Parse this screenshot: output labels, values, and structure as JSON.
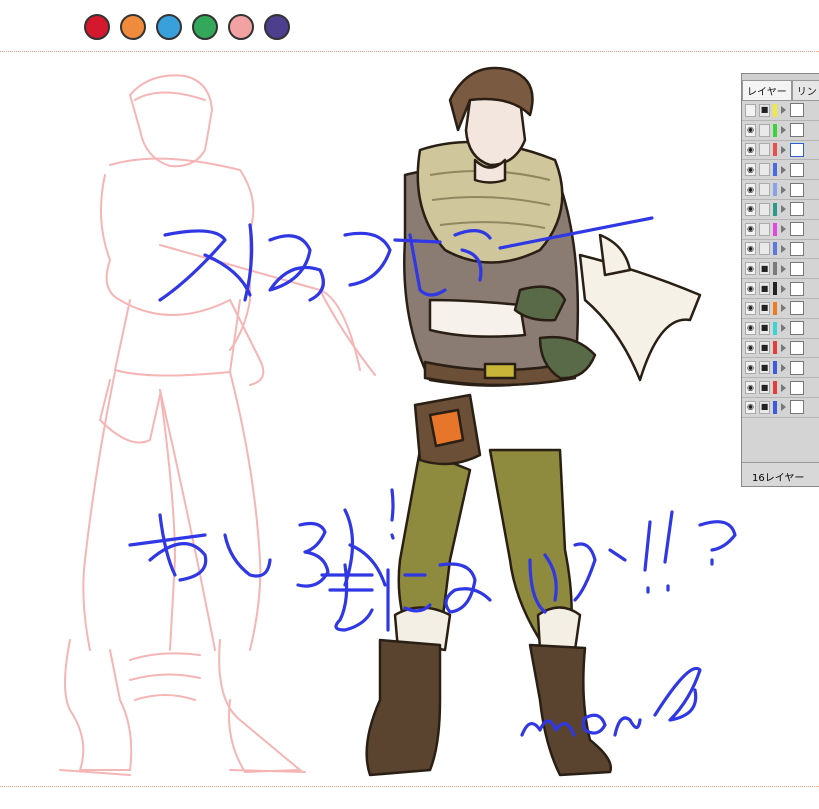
{
  "palette": [
    {
      "name": "red",
      "color": "#d4182e"
    },
    {
      "name": "orange",
      "color": "#f08a3c"
    },
    {
      "name": "blue",
      "color": "#3aa0dc"
    },
    {
      "name": "green",
      "color": "#34a85a"
    },
    {
      "name": "pink",
      "color": "#f2a2a2"
    },
    {
      "name": "purple",
      "color": "#4e3e8e"
    }
  ],
  "ink_color": "#2f38e4",
  "sketch_color": "#f6b5b5",
  "layers_panel": {
    "tabs": [
      "レイヤー",
      "リン"
    ],
    "footer": "16レイヤー",
    "rows": [
      {
        "eye": false,
        "lock": true,
        "color": "#f2ea3a"
      },
      {
        "eye": true,
        "lock": false,
        "color": "#3ad43a"
      },
      {
        "eye": true,
        "lock": false,
        "color": "#e85050"
      },
      {
        "eye": true,
        "lock": false,
        "color": "#4a6ae0"
      },
      {
        "eye": true,
        "lock": false,
        "color": "#8aa0e8"
      },
      {
        "eye": true,
        "lock": false,
        "color": "#2a9a8a"
      },
      {
        "eye": true,
        "lock": false,
        "color": "#e04ae0"
      },
      {
        "eye": true,
        "lock": false,
        "color": "#5a78e0"
      },
      {
        "eye": true,
        "lock": true,
        "color": "#7a7a7a"
      },
      {
        "eye": true,
        "lock": true,
        "color": "#222222"
      },
      {
        "eye": true,
        "lock": true,
        "color": "#f07a20"
      },
      {
        "eye": true,
        "lock": true,
        "color": "#3ad4d4"
      },
      {
        "eye": true,
        "lock": true,
        "color": "#e83a3a"
      },
      {
        "eye": true,
        "lock": true,
        "color": "#3a5ae0"
      },
      {
        "eye": true,
        "lock": true,
        "color": "#e83a3a"
      },
      {
        "eye": true,
        "lock": true,
        "color": "#3a5ae0"
      }
    ]
  }
}
